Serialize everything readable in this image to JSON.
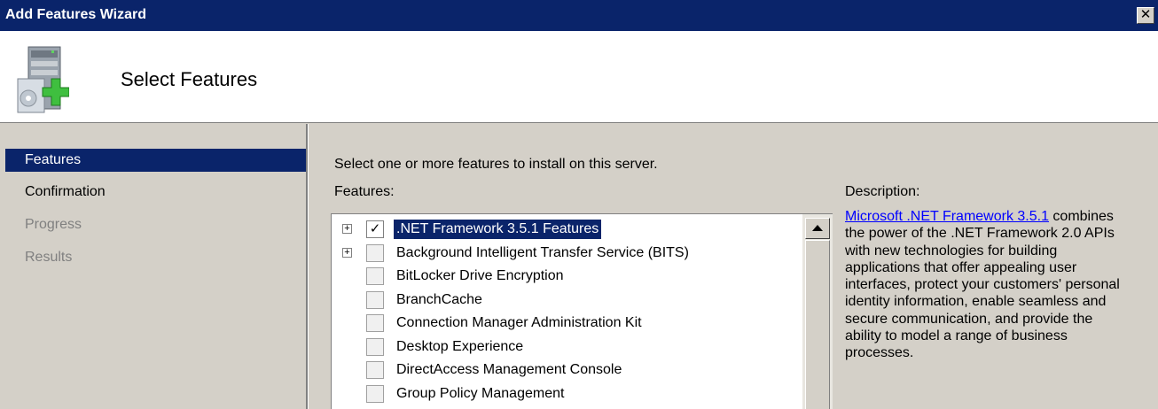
{
  "window": {
    "title": "Add Features Wizard",
    "close_glyph": "✕"
  },
  "header": {
    "title": "Select Features",
    "icon": "server-add-icon"
  },
  "nav": {
    "items": [
      {
        "label": "Features",
        "state": "active"
      },
      {
        "label": "Confirmation",
        "state": "enabled"
      },
      {
        "label": "Progress",
        "state": "disabled"
      },
      {
        "label": "Results",
        "state": "disabled"
      }
    ]
  },
  "main": {
    "instruction": "Select one or more features to install on this server.",
    "features_label": "Features:",
    "description_label": "Description:"
  },
  "features": [
    {
      "label": ".NET Framework 3.5.1 Features",
      "checked": true,
      "expandable": true,
      "selected": true
    },
    {
      "label": "Background Intelligent Transfer Service (BITS)",
      "checked": false,
      "expandable": true,
      "selected": false
    },
    {
      "label": "BitLocker Drive Encryption",
      "checked": false,
      "expandable": false,
      "selected": false
    },
    {
      "label": "BranchCache",
      "checked": false,
      "expandable": false,
      "selected": false
    },
    {
      "label": "Connection Manager Administration Kit",
      "checked": false,
      "expandable": false,
      "selected": false
    },
    {
      "label": "Desktop Experience",
      "checked": false,
      "expandable": false,
      "selected": false
    },
    {
      "label": "DirectAccess Management Console",
      "checked": false,
      "expandable": false,
      "selected": false
    },
    {
      "label": "Group Policy Management",
      "checked": false,
      "expandable": false,
      "selected": false
    }
  ],
  "description": {
    "link_text": "Microsoft .NET Framework 3.5.1",
    "body": " combines the power of the .NET Framework 2.0 APIs with new technologies for building applications that offer appealing user interfaces, protect your customers' personal identity information, enable seamless and secure communication, and provide the ability to model a range of business processes."
  },
  "colors": {
    "titlebar": "#0a246a",
    "selection": "#0a246a",
    "link": "#0000ff",
    "window_bg": "#d4d0c8"
  }
}
